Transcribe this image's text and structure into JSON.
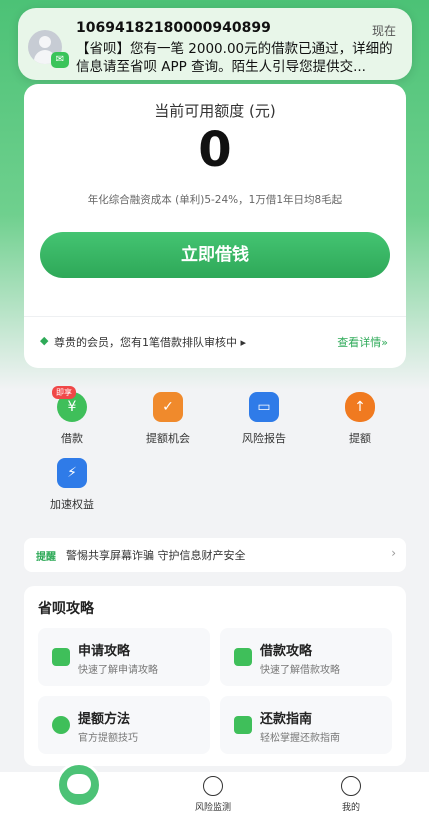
{
  "notification": {
    "sender": "10694182180000940899",
    "time": "现在",
    "body": "【省呗】您有一笔 2000.00元的借款已通过，详细的信息请至省呗 APP 查询。陌生人引导您提供交..."
  },
  "card": {
    "credit_label": "当前可用额度 (元)",
    "credit_amount": "0",
    "rate_text": "年化综合融资成本 (单利)5-24%，1万借1年日均8毛起",
    "borrow_button": "立即借钱",
    "vip_text": "尊贵的会员，您有1笔借款排队审核中 ▸",
    "details_link": "查看详情»"
  },
  "grid": [
    {
      "label": "借款",
      "badge": "即享",
      "icon": "loan-icon",
      "color": "#3fbf5a"
    },
    {
      "label": "提额机会",
      "icon": "gift-icon",
      "color": "#f08a2c"
    },
    {
      "label": "风险报告",
      "icon": "report-icon",
      "color": "#2f7be8"
    },
    {
      "label": "提额",
      "icon": "money-bag-icon",
      "color": "#f07a20"
    },
    {
      "label": "加速权益",
      "icon": "speed-icon",
      "color": "#2f7be8"
    }
  ],
  "reminder": {
    "tag": "提醒",
    "text": "警惕共享屏幕诈骗 守护信息财产安全",
    "arrow": "›"
  },
  "guide": {
    "title": "省呗攻略",
    "items": [
      {
        "title": "申请攻略",
        "subtitle": "快速了解申请攻略",
        "color": "#3fbf5a"
      },
      {
        "title": "借款攻略",
        "subtitle": "快速了解借款攻略",
        "color": "#3fbf5a"
      },
      {
        "title": "提额方法",
        "subtitle": "官方提额技巧",
        "color": "#3fbf5a"
      },
      {
        "title": "还款指南",
        "subtitle": "轻松掌握还款指南",
        "color": "#3fbf5a"
      }
    ]
  },
  "bottom_nav": {
    "risk_monitor": "风险监测",
    "mine": "我的"
  }
}
